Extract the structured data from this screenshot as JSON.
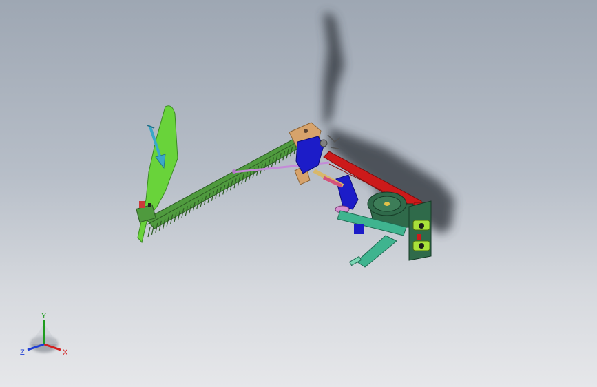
{
  "viewport": {
    "background_top": "#9ea7b3",
    "background_bottom": "#e6e7ea"
  },
  "model": {
    "colors": {
      "deflector_plate": "#69d33a",
      "cutter_bar": "#4f9a3e",
      "gearbox_housing": "#1c1cc8",
      "main_beam": "#cc1a1a",
      "drive_shaft": "#3fb48f",
      "pulley": "#2f6a4a",
      "bracket": "#d7a36b",
      "connecting_rod": "#c58ad8",
      "arrow": "#3aa8c8",
      "shadow": "#3a3f46"
    }
  },
  "triad": {
    "x_label": "X",
    "y_label": "Y",
    "z_label": "Z",
    "x_color": "#d42020",
    "y_color": "#1e9c1e",
    "z_color": "#1e3ed4"
  }
}
